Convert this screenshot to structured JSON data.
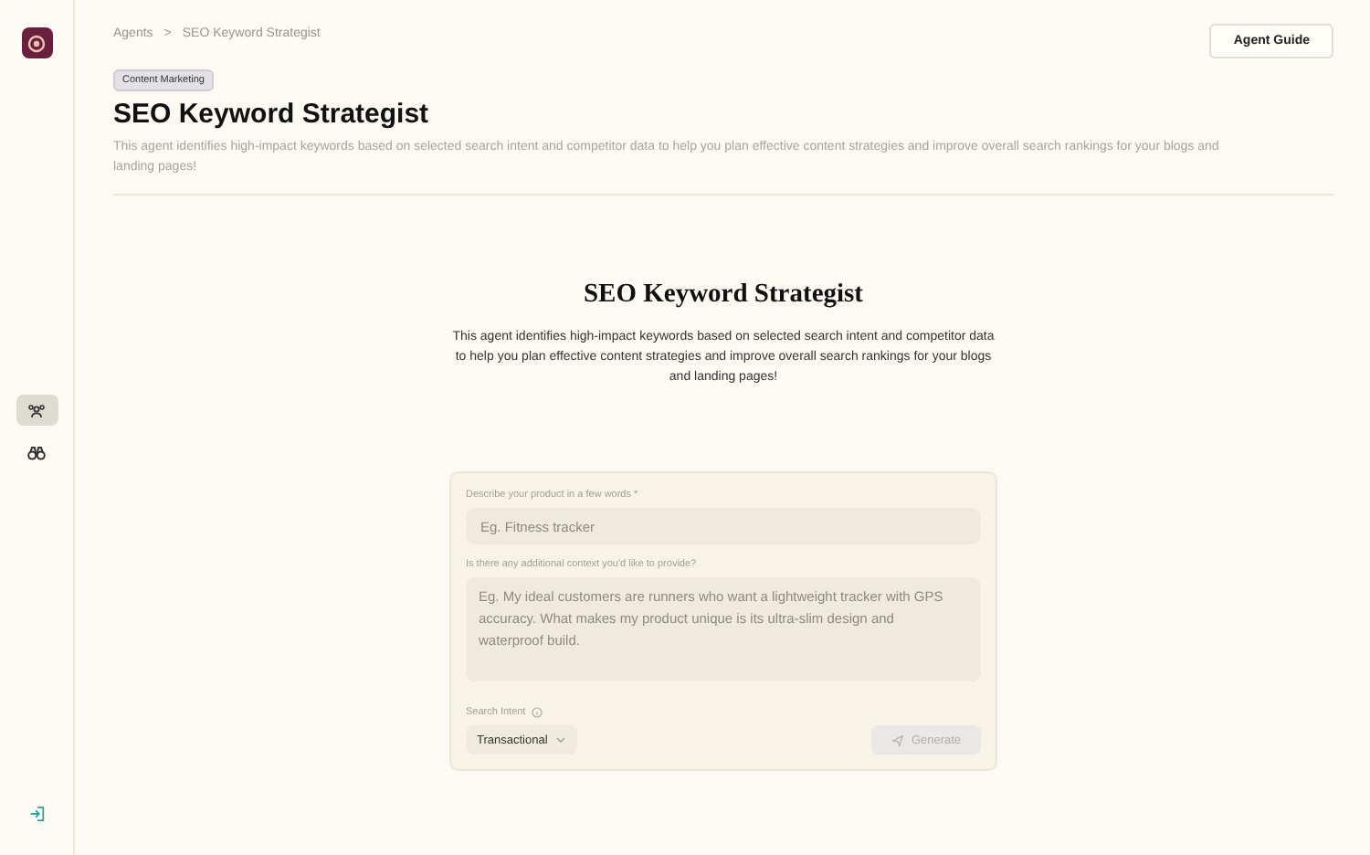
{
  "breadcrumb": [
    {
      "label": "Agents"
    },
    {
      "label": "SEO Keyword Strategist"
    }
  ],
  "breadcrumb_separator": ">",
  "agent_guide_button": "Agent Guide",
  "tag": "Content Marketing",
  "title": "SEO Keyword Strategist",
  "description": "This agent identifies high-impact keywords based on selected search intent and competitor data to help you plan effective content strategies and improve overall search rankings for your blogs and landing pages!",
  "sidebar": {
    "items": [
      {
        "kind": "agents",
        "selected": true
      },
      {
        "kind": "binoculars",
        "selected": false
      }
    ]
  },
  "hero": {
    "title": "SEO Keyword Strategist",
    "description": "This agent identifies high-impact keywords based on selected search intent and competitor data to help you plan effective content strategies and improve overall search rankings for your blogs and landing pages!"
  },
  "form": {
    "product_label": "Describe your product in a few words *",
    "product_placeholder": "Eg. Fitness tracker",
    "context_label": "Is there any additional context you'd like to provide?",
    "context_placeholder": "Eg. My ideal customers are runners who want a lightweight tracker with GPS accuracy. What makes my product unique is its ultra-slim design and waterproof build.",
    "intent_label": "Search Intent",
    "intent_value": "Transactional",
    "generate_button": "Generate",
    "generate_disabled": true
  }
}
